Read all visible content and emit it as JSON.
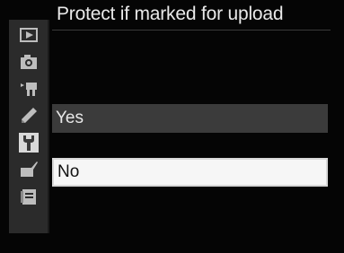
{
  "menu": {
    "title": "Protect if marked for upload"
  },
  "options": [
    {
      "label": "Yes",
      "selected": false
    },
    {
      "label": "No",
      "selected": true
    }
  ],
  "rail": {
    "icons": [
      "playback-menu-icon",
      "shooting-menu-icon",
      "movie-menu-icon",
      "custom-settings-pencil-icon",
      "setup-wrench-icon",
      "retouch-brush-icon",
      "my-menu-icon"
    ],
    "active_index": 4
  },
  "colors": {
    "highlight": "#f6f6f6",
    "option_bg": "#3b3b3b",
    "rail_bg": "#2b2b2b"
  }
}
